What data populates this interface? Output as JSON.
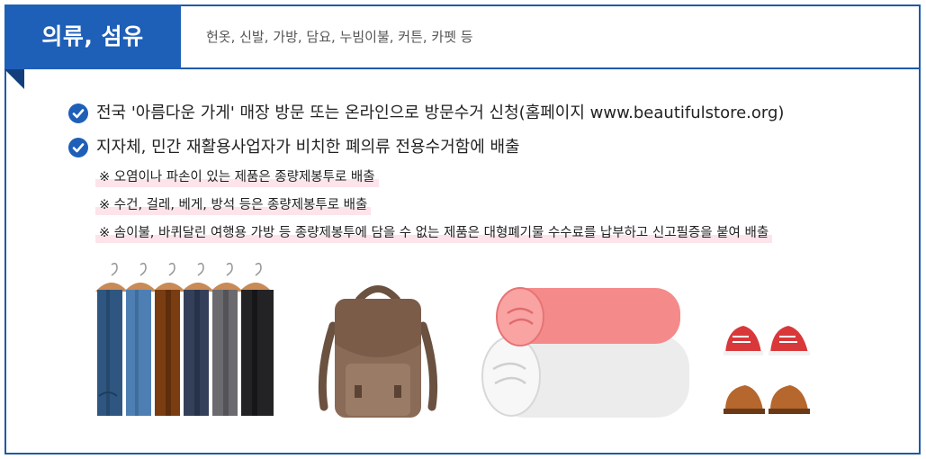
{
  "header": {
    "category_title": "의류, 섬유",
    "items": "헌옷, 신발, 가방, 담요, 누빔이불, 커튼, 카펫 등"
  },
  "bullets": [
    {
      "icon": "check-circle-icon",
      "text": "전국 '아름다운 가게' 매장 방문 또는 온라인으로 방문수거 신청(홈페이지 www.beautifulstore.org)"
    },
    {
      "icon": "check-circle-icon",
      "text": "지자체, 민간 재활용사업자가 비치한 폐의류 전용수거함에 배출"
    }
  ],
  "notes": [
    "※ 오염이나 파손이 있는 제품은 종량제봉투로 배출",
    "※ 수건, 걸레, 베게, 방석 등은 종량제봉투로 배출",
    "※ 솜이불, 바퀴달린 여행용 가방 등 종량제봉투에 담을 수 없는 제품은 대형폐기물 수수료를 납부하고 신고필증을 붙여 배출"
  ],
  "illustrations": [
    "clothes-on-hangers",
    "backpack",
    "folded-blankets",
    "shoes"
  ],
  "colors": {
    "brand_blue": "#1e5fb8",
    "border_blue": "#1e5aa8",
    "note_highlight": "#fde4ea"
  }
}
